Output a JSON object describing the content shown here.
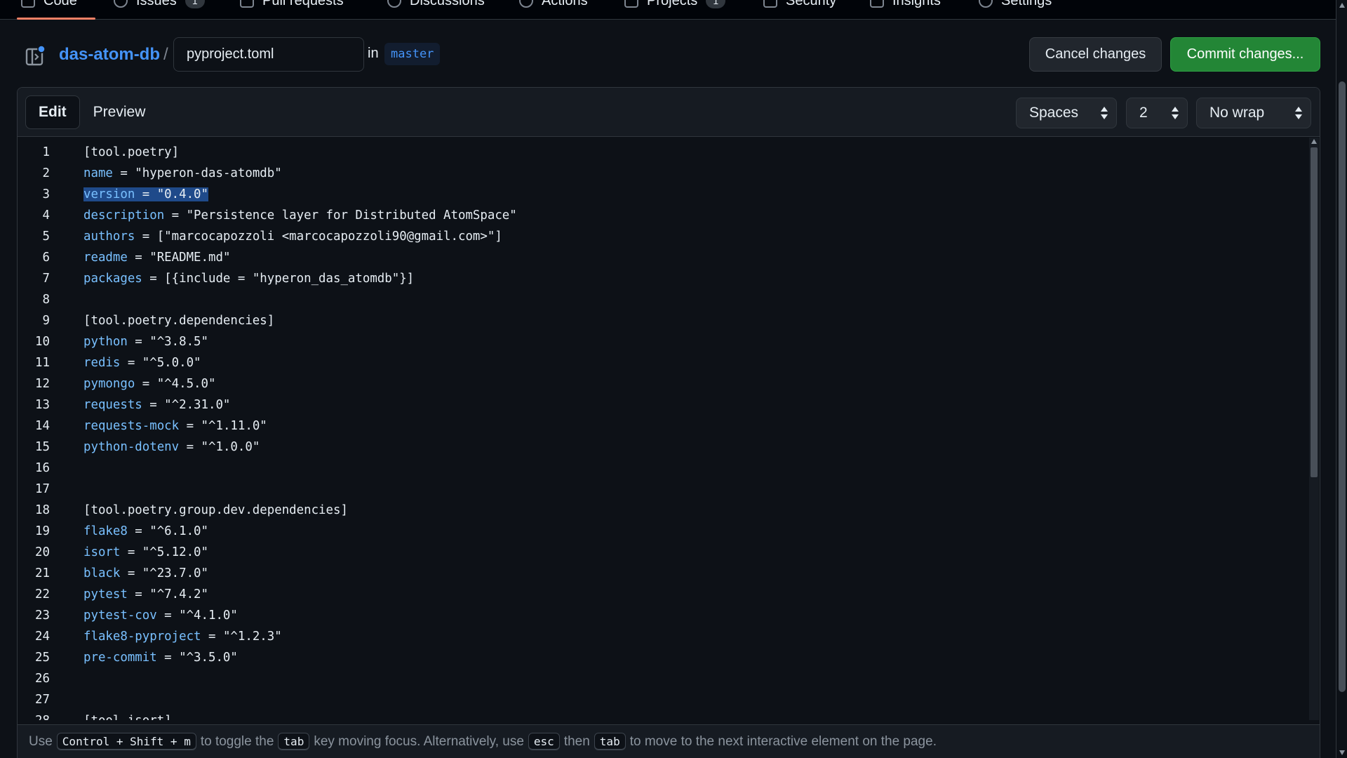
{
  "nav": {
    "tabs": [
      {
        "label": "Code",
        "icon": "code-icon"
      },
      {
        "label": "Issues",
        "icon": "issue-opened-icon",
        "count": "1"
      },
      {
        "label": "Pull requests",
        "icon": "git-pull-request-icon"
      },
      {
        "label": "Discussions",
        "icon": "comment-discussion-icon"
      },
      {
        "label": "Actions",
        "icon": "play-icon"
      },
      {
        "label": "Projects",
        "icon": "table-icon",
        "count": "1"
      },
      {
        "label": "Security",
        "icon": "shield-icon"
      },
      {
        "label": "Insights",
        "icon": "graph-icon"
      },
      {
        "label": "Settings",
        "icon": "gear-icon"
      }
    ],
    "active_tab": "Code",
    "accent_color": "#f78166"
  },
  "file_header": {
    "repo": "das-atom-db",
    "separator": "/",
    "filename": "pyproject.toml",
    "in_label": "in",
    "branch": "master",
    "cancel_label": "Cancel changes",
    "commit_label": "Commit changes..."
  },
  "editor": {
    "tabs": [
      "Edit",
      "Preview"
    ],
    "active_tab": "Edit",
    "indent_mode": "Spaces",
    "indent_size": "2",
    "wrap_mode": "No wrap",
    "selected_line": 3,
    "lines": [
      {
        "n": "1",
        "text": "[tool.poetry]",
        "kind": "header"
      },
      {
        "n": "2",
        "key": "name",
        "val": " = \"hyperon-das-atomdb\""
      },
      {
        "n": "3",
        "key": "version",
        "val": " = \"0.4.0\"",
        "selected": true
      },
      {
        "n": "4",
        "key": "description",
        "val": " = \"Persistence layer for Distributed AtomSpace\""
      },
      {
        "n": "5",
        "key": "authors",
        "val": " = [\"marcocapozzoli <marcocapozzoli90@gmail.com>\"]"
      },
      {
        "n": "6",
        "key": "readme",
        "val": " = \"README.md\""
      },
      {
        "n": "7",
        "key": "packages",
        "val": " = [{include = \"hyperon_das_atomdb\"}]"
      },
      {
        "n": "8",
        "text": ""
      },
      {
        "n": "9",
        "text": "[tool.poetry.dependencies]",
        "kind": "header"
      },
      {
        "n": "10",
        "key": "python",
        "val": " = \"^3.8.5\""
      },
      {
        "n": "11",
        "key": "redis",
        "val": " = \"^5.0.0\""
      },
      {
        "n": "12",
        "key": "pymongo",
        "val": " = \"^4.5.0\""
      },
      {
        "n": "13",
        "key": "requests",
        "val": " = \"^2.31.0\""
      },
      {
        "n": "14",
        "key": "requests-mock",
        "val": " = \"^1.11.0\""
      },
      {
        "n": "15",
        "key": "python-dotenv",
        "val": " = \"^1.0.0\""
      },
      {
        "n": "16",
        "text": ""
      },
      {
        "n": "17",
        "text": ""
      },
      {
        "n": "18",
        "text": "[tool.poetry.group.dev.dependencies]",
        "kind": "header"
      },
      {
        "n": "19",
        "key": "flake8",
        "val": " = \"^6.1.0\""
      },
      {
        "n": "20",
        "key": "isort",
        "val": " = \"^5.12.0\""
      },
      {
        "n": "21",
        "key": "black",
        "val": " = \"^23.7.0\""
      },
      {
        "n": "22",
        "key": "pytest",
        "val": " = \"^7.4.2\""
      },
      {
        "n": "23",
        "key": "pytest-cov",
        "val": " = \"^4.1.0\""
      },
      {
        "n": "24",
        "key": "flake8-pyproject",
        "val": " = \"^1.2.3\""
      },
      {
        "n": "25",
        "key": "pre-commit",
        "val": " = \"^3.5.0\""
      },
      {
        "n": "26",
        "text": ""
      },
      {
        "n": "27",
        "text": ""
      },
      {
        "n": "28",
        "text": "[tool.isort]",
        "kind": "header"
      }
    ]
  },
  "hint": {
    "use": "Use",
    "shortcut": "Control + Shift + m",
    "to_toggle": "to toggle the",
    "tab_key": "tab",
    "key_moving": "key moving focus. Alternatively, use",
    "esc_key": "esc",
    "then": "then",
    "tab_key2": "tab",
    "to_move": "to move to the next interactive element on the page."
  },
  "colors": {
    "background": "#0d1117",
    "key_color": "#79c0ff",
    "link_color": "#4493f8",
    "commit_button": "#238636",
    "selection": "#1f4a8a"
  }
}
